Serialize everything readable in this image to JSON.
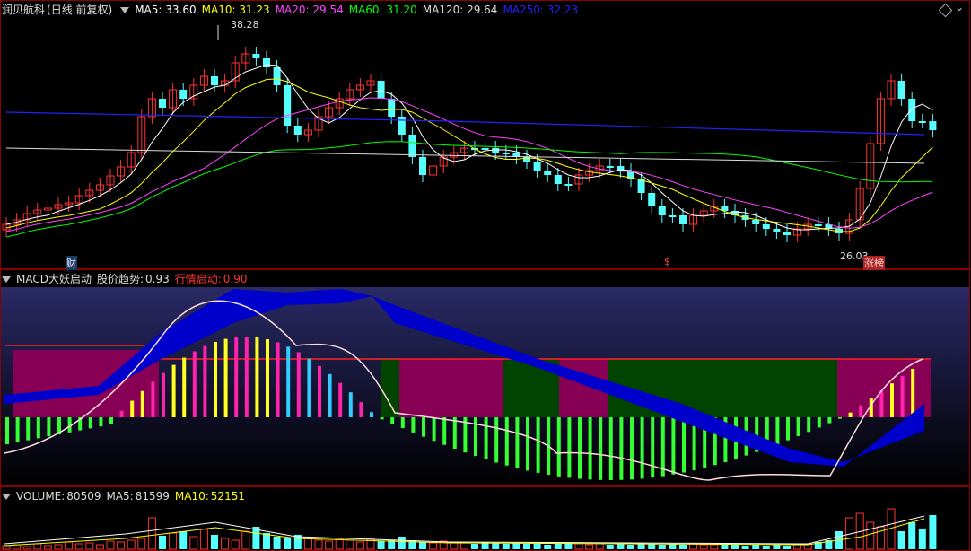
{
  "main": {
    "stock_name": "润贝航科",
    "period": "(日线 前复权)",
    "ma_labels": [
      {
        "name": "MA5",
        "value": "33.60",
        "color": "#ffffff"
      },
      {
        "name": "MA10",
        "value": "31.23",
        "color": "#ffff00"
      },
      {
        "name": "MA20",
        "value": "29.54",
        "color": "#ff44ff"
      },
      {
        "name": "MA60",
        "value": "31.20",
        "color": "#00ff00"
      },
      {
        "name": "MA120",
        "value": "29.64",
        "color": "#dddddd"
      },
      {
        "name": "MA250",
        "value": "32.23",
        "color": "#2222ff"
      }
    ],
    "high_label": "38.28",
    "low_label": "26.03",
    "badge_cai": "财",
    "badge_dollar": "$",
    "badge_zhangbang": "涨榜"
  },
  "indicator": {
    "name": "MACD大妖启动",
    "trend_label": "股价趋势:",
    "trend_value": "0.93",
    "start_label": "行情启动:",
    "start_value": "0.90"
  },
  "volume": {
    "name": "VOLUME:",
    "value": "80509",
    "ma5_label": "MA5:",
    "ma5_value": "81599",
    "ma10_label": "MA10:",
    "ma10_value": "52151"
  },
  "colors": {
    "up": "#ff3333",
    "down": "#54ffff",
    "ma250": "#2222ff",
    "border": "#aa0000"
  }
}
